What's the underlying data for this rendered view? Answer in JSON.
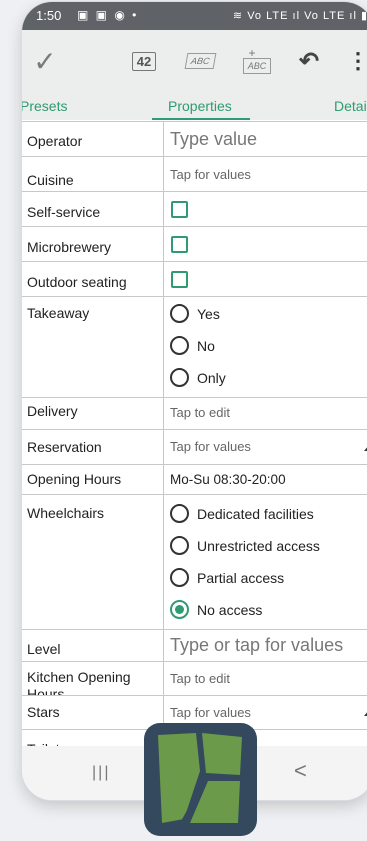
{
  "status": {
    "time": "1:50",
    "icons_left": "▣ ▣ ◉ •",
    "icons_right": "≋ Vo LTE ıl Vo LTE ıl ▮"
  },
  "toolbar": {
    "num_label": "42",
    "abc_label": "ABC",
    "abc2_label": "ABC",
    "plus": "+",
    "more": "⋮",
    "check": "✓",
    "undo": "↶"
  },
  "tabs": {
    "presets": "Presets",
    "properties": "Properties",
    "details": "Detai"
  },
  "rows": [
    {
      "key": "Operator",
      "value": "Type value"
    },
    {
      "key": "Cuisine",
      "value": "Tap for values"
    },
    {
      "key": "Self-service"
    },
    {
      "key": "Microbrewery"
    },
    {
      "key": "Outdoor seating"
    },
    {
      "key": "Takeaway",
      "options": [
        "Yes",
        "No",
        "Only"
      ]
    },
    {
      "key": "Delivery",
      "value": "Tap to edit"
    },
    {
      "key": "Reservation",
      "value": "Tap for values"
    },
    {
      "key": "Opening Hours",
      "value": "Mo-Su 08:30-20:00"
    },
    {
      "key": "Wheelchairs",
      "options": [
        "Dedicated facilities",
        "Unrestricted access",
        "Partial access",
        "No access"
      ],
      "selected": "No access"
    },
    {
      "key": "Level",
      "value": "Type or tap for values"
    },
    {
      "key": "Kitchen Opening Hours",
      "value": "Tap to edit"
    },
    {
      "key": "Stars",
      "value": "Tap for values"
    },
    {
      "key": "Toilets"
    }
  ],
  "nav": {
    "recent": "|||",
    "back": "<"
  },
  "colors": {
    "accent": "#2e9b72",
    "toolbar": "#eceeed",
    "logo_bg": "#34495e",
    "logo_fg": "#6b9a4a"
  }
}
